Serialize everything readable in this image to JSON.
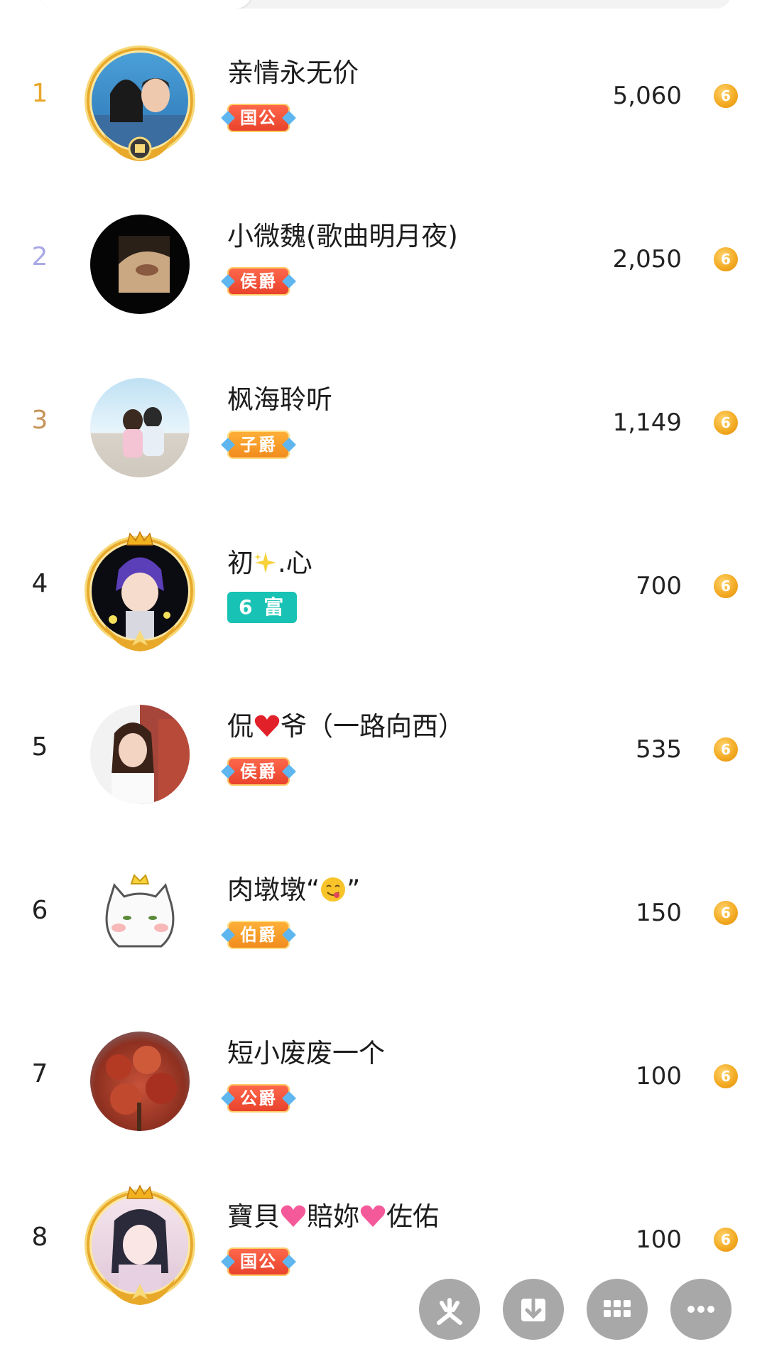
{
  "leaderboard": [
    {
      "rank": "1",
      "name": "亲情永无价",
      "badge": "国公",
      "badge_style": "red",
      "score": "5,060",
      "rank_color": "#e9a82b"
    },
    {
      "rank": "2",
      "name": "小微魏(歌曲明月夜)",
      "badge": "侯爵",
      "badge_style": "red",
      "score": "2,050",
      "rank_color": "#a9a8e6"
    },
    {
      "rank": "3",
      "name": "枫海聆听",
      "badge": "子爵",
      "badge_style": "orange",
      "score": "1,149",
      "rank_color": "#c7945a"
    },
    {
      "rank": "4",
      "name_parts": [
        "初",
        ".心"
      ],
      "badge": "6 富",
      "badge_style": "teal",
      "score": "700",
      "rank_color": "#222222"
    },
    {
      "rank": "5",
      "name_parts": [
        "侃",
        "爷（一路向西）"
      ],
      "badge": "侯爵",
      "badge_style": "red",
      "score": "535",
      "rank_color": "#222222"
    },
    {
      "rank": "6",
      "name_parts": [
        "肉墩墩“",
        "”"
      ],
      "badge": "伯爵",
      "badge_style": "orange",
      "score": "150",
      "rank_color": "#222222"
    },
    {
      "rank": "7",
      "name": "短小废废一个",
      "badge": "公爵",
      "badge_style": "red",
      "score": "100",
      "rank_color": "#222222"
    },
    {
      "rank": "8",
      "name_parts": [
        "寶貝",
        "賠妳",
        "佐佑"
      ],
      "badge": "国公",
      "badge_style": "red",
      "score": "100",
      "rank_color": "#222222"
    }
  ],
  "coin_glyph": "6",
  "floating_buttons": [
    "share",
    "download",
    "apps",
    "more"
  ],
  "icons": {
    "coin": "coin-icon",
    "sparkle": "sparkle-emoji",
    "heart": "heart-emoji",
    "face": "yum-face-emoji"
  }
}
